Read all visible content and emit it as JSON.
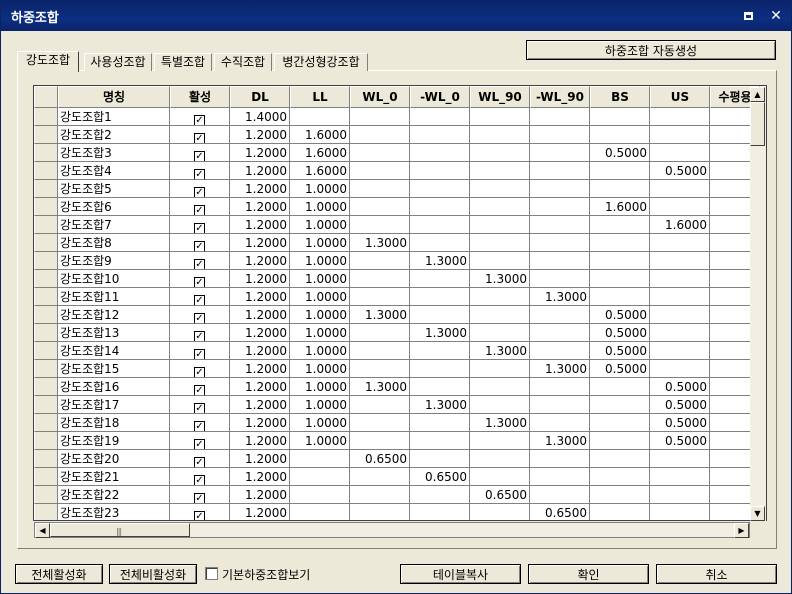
{
  "window": {
    "title": "하중조합"
  },
  "toolbar": {
    "auto_generate_label": "하중조합 자동생성"
  },
  "tabs": [
    {
      "label": "강도조합",
      "active": true
    },
    {
      "label": "사용성조합",
      "active": false
    },
    {
      "label": "특별조합",
      "active": false
    },
    {
      "label": "수직조합",
      "active": false
    },
    {
      "label": "병간성형강조합",
      "active": false
    }
  ],
  "table": {
    "columns": [
      "명칭",
      "활성",
      "DL",
      "LL",
      "WL_0",
      "-WL_0",
      "WL_90",
      "-WL_90",
      "BS",
      "US",
      "수평용"
    ],
    "check_mark": "✓",
    "rows": [
      {
        "name": "강도조합1",
        "active": true,
        "DL": "1.4000",
        "LL": "",
        "WL_0": "",
        "-WL_0": "",
        "WL_90": "",
        "-WL_90": "",
        "BS": "",
        "US": ""
      },
      {
        "name": "강도조합2",
        "active": true,
        "DL": "1.2000",
        "LL": "1.6000",
        "WL_0": "",
        "-WL_0": "",
        "WL_90": "",
        "-WL_90": "",
        "BS": "",
        "US": ""
      },
      {
        "name": "강도조합3",
        "active": true,
        "DL": "1.2000",
        "LL": "1.6000",
        "WL_0": "",
        "-WL_0": "",
        "WL_90": "",
        "-WL_90": "",
        "BS": "0.5000",
        "US": ""
      },
      {
        "name": "강도조합4",
        "active": true,
        "DL": "1.2000",
        "LL": "1.6000",
        "WL_0": "",
        "-WL_0": "",
        "WL_90": "",
        "-WL_90": "",
        "BS": "",
        "US": "0.5000"
      },
      {
        "name": "강도조합5",
        "active": true,
        "DL": "1.2000",
        "LL": "1.0000",
        "WL_0": "",
        "-WL_0": "",
        "WL_90": "",
        "-WL_90": "",
        "BS": "",
        "US": ""
      },
      {
        "name": "강도조합6",
        "active": true,
        "DL": "1.2000",
        "LL": "1.0000",
        "WL_0": "",
        "-WL_0": "",
        "WL_90": "",
        "-WL_90": "",
        "BS": "1.6000",
        "US": ""
      },
      {
        "name": "강도조합7",
        "active": true,
        "DL": "1.2000",
        "LL": "1.0000",
        "WL_0": "",
        "-WL_0": "",
        "WL_90": "",
        "-WL_90": "",
        "BS": "",
        "US": "1.6000"
      },
      {
        "name": "강도조합8",
        "active": true,
        "DL": "1.2000",
        "LL": "1.0000",
        "WL_0": "1.3000",
        "-WL_0": "",
        "WL_90": "",
        "-WL_90": "",
        "BS": "",
        "US": ""
      },
      {
        "name": "강도조합9",
        "active": true,
        "DL": "1.2000",
        "LL": "1.0000",
        "WL_0": "",
        "-WL_0": "1.3000",
        "WL_90": "",
        "-WL_90": "",
        "BS": "",
        "US": ""
      },
      {
        "name": "강도조합10",
        "active": true,
        "DL": "1.2000",
        "LL": "1.0000",
        "WL_0": "",
        "-WL_0": "",
        "WL_90": "1.3000",
        "-WL_90": "",
        "BS": "",
        "US": ""
      },
      {
        "name": "강도조합11",
        "active": true,
        "DL": "1.2000",
        "LL": "1.0000",
        "WL_0": "",
        "-WL_0": "",
        "WL_90": "",
        "-WL_90": "1.3000",
        "BS": "",
        "US": ""
      },
      {
        "name": "강도조합12",
        "active": true,
        "DL": "1.2000",
        "LL": "1.0000",
        "WL_0": "1.3000",
        "-WL_0": "",
        "WL_90": "",
        "-WL_90": "",
        "BS": "0.5000",
        "US": ""
      },
      {
        "name": "강도조합13",
        "active": true,
        "DL": "1.2000",
        "LL": "1.0000",
        "WL_0": "",
        "-WL_0": "1.3000",
        "WL_90": "",
        "-WL_90": "",
        "BS": "0.5000",
        "US": ""
      },
      {
        "name": "강도조합14",
        "active": true,
        "DL": "1.2000",
        "LL": "1.0000",
        "WL_0": "",
        "-WL_0": "",
        "WL_90": "1.3000",
        "-WL_90": "",
        "BS": "0.5000",
        "US": ""
      },
      {
        "name": "강도조합15",
        "active": true,
        "DL": "1.2000",
        "LL": "1.0000",
        "WL_0": "",
        "-WL_0": "",
        "WL_90": "",
        "-WL_90": "1.3000",
        "BS": "0.5000",
        "US": ""
      },
      {
        "name": "강도조합16",
        "active": true,
        "DL": "1.2000",
        "LL": "1.0000",
        "WL_0": "1.3000",
        "-WL_0": "",
        "WL_90": "",
        "-WL_90": "",
        "BS": "",
        "US": "0.5000"
      },
      {
        "name": "강도조합17",
        "active": true,
        "DL": "1.2000",
        "LL": "1.0000",
        "WL_0": "",
        "-WL_0": "1.3000",
        "WL_90": "",
        "-WL_90": "",
        "BS": "",
        "US": "0.5000"
      },
      {
        "name": "강도조합18",
        "active": true,
        "DL": "1.2000",
        "LL": "1.0000",
        "WL_0": "",
        "-WL_0": "",
        "WL_90": "1.3000",
        "-WL_90": "",
        "BS": "",
        "US": "0.5000"
      },
      {
        "name": "강도조합19",
        "active": true,
        "DL": "1.2000",
        "LL": "1.0000",
        "WL_0": "",
        "-WL_0": "",
        "WL_90": "",
        "-WL_90": "1.3000",
        "BS": "",
        "US": "0.5000"
      },
      {
        "name": "강도조합20",
        "active": true,
        "DL": "1.2000",
        "LL": "",
        "WL_0": "0.6500",
        "-WL_0": "",
        "WL_90": "",
        "-WL_90": "",
        "BS": "",
        "US": ""
      },
      {
        "name": "강도조합21",
        "active": true,
        "DL": "1.2000",
        "LL": "",
        "WL_0": "",
        "-WL_0": "0.6500",
        "WL_90": "",
        "-WL_90": "",
        "BS": "",
        "US": ""
      },
      {
        "name": "강도조합22",
        "active": true,
        "DL": "1.2000",
        "LL": "",
        "WL_0": "",
        "-WL_0": "",
        "WL_90": "0.6500",
        "-WL_90": "",
        "BS": "",
        "US": ""
      },
      {
        "name": "강도조합23",
        "active": true,
        "DL": "1.2000",
        "LL": "",
        "WL_0": "",
        "-WL_0": "",
        "WL_90": "",
        "-WL_90": "0.6500",
        "BS": "",
        "US": ""
      }
    ]
  },
  "scrollbars": {
    "vertical": {
      "up_glyph": "▲",
      "down_glyph": "▼"
    },
    "horizontal": {
      "left_glyph": "◀",
      "right_glyph": "▶",
      "grip_glyph": "|||"
    }
  },
  "footer": {
    "activate_all_label": "전체활성화",
    "deactivate_all_label": "전체비활성화",
    "show_default_label": "기본하중조합보기",
    "show_default_checked": false,
    "copy_table_label": "테이블복사",
    "ok_label": "확인",
    "cancel_label": "취소"
  },
  "icons": {
    "restore": "restore-icon",
    "close": "close-icon",
    "close_glyph": "✕"
  }
}
